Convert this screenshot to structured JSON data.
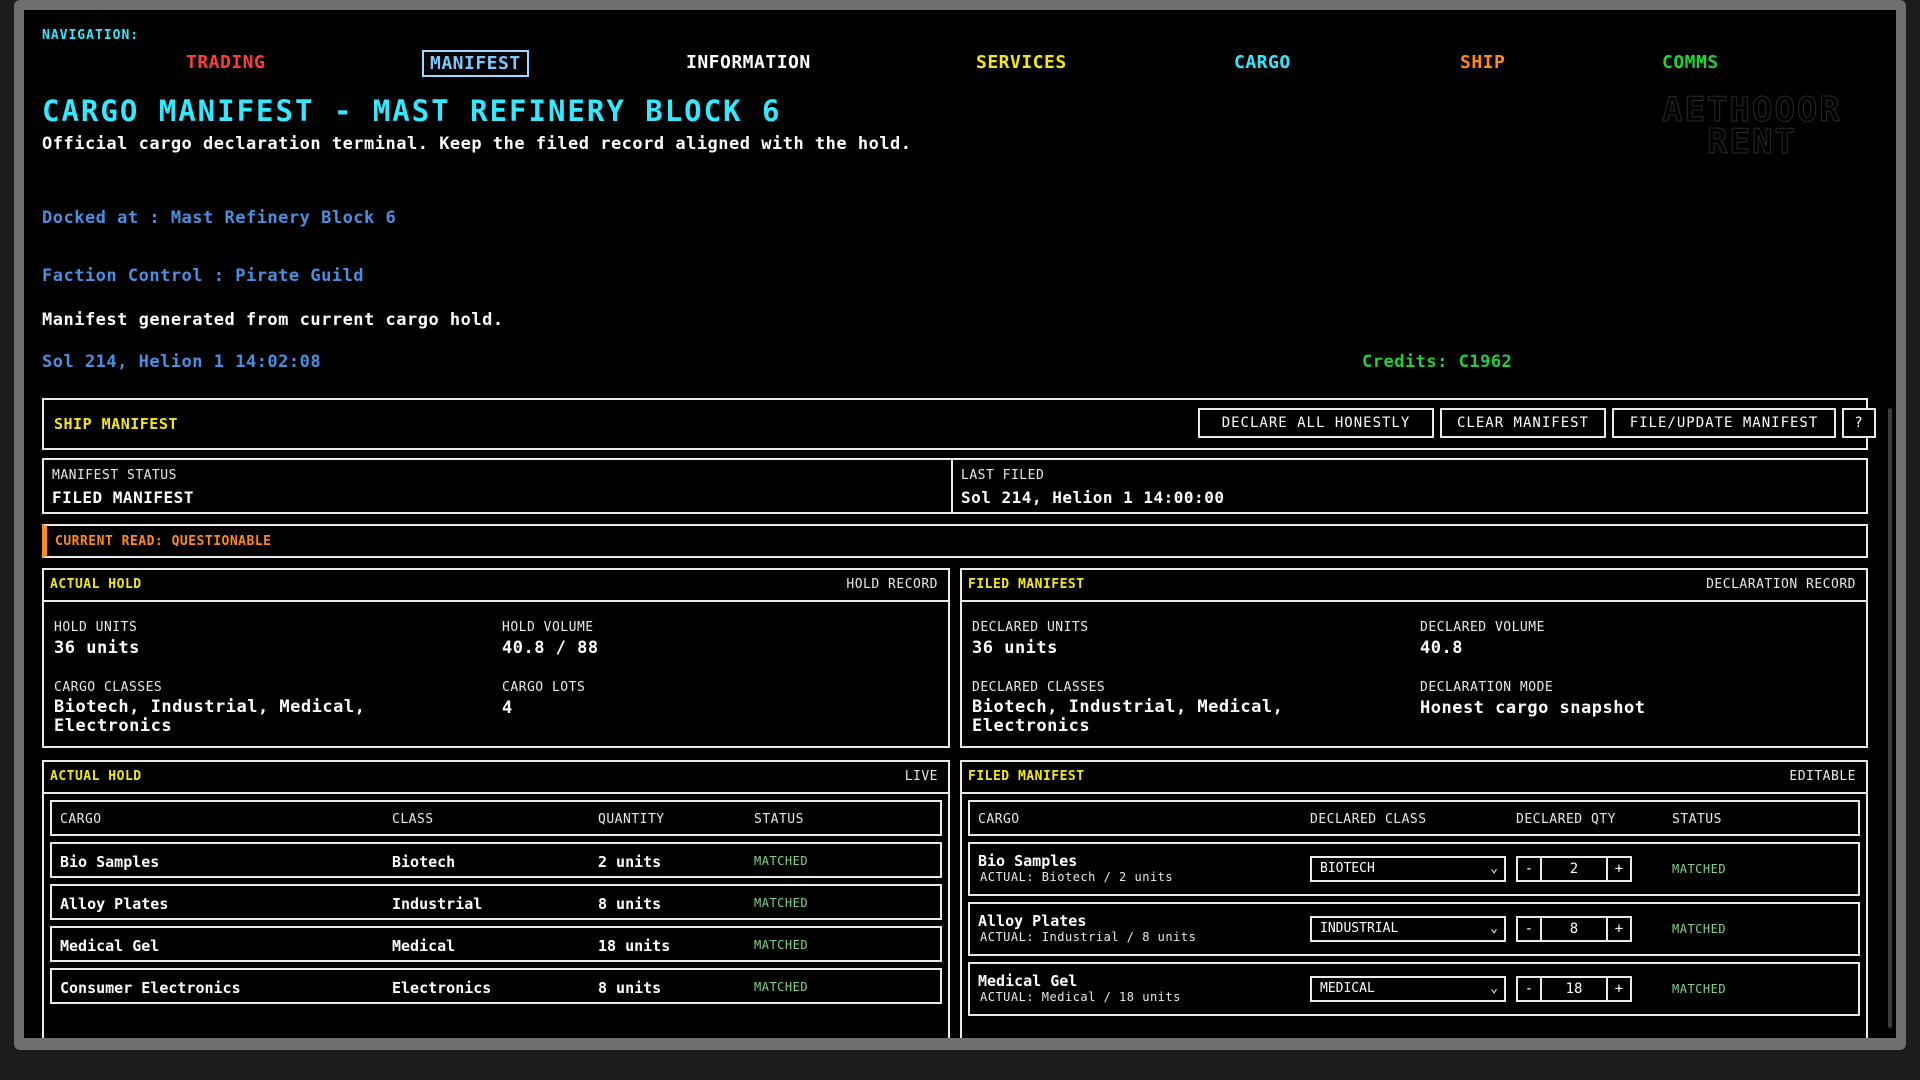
{
  "nav": {
    "label": "NAVIGATION:",
    "items": [
      {
        "label": "TRADING",
        "color": "#ff3b3b"
      },
      {
        "label": "MANIFEST",
        "color": "#7ec8ff"
      },
      {
        "label": "INFORMATION",
        "color": "#ffffff"
      },
      {
        "label": "SERVICES",
        "color": "#f4e61a"
      },
      {
        "label": "CARGO",
        "color": "#34e8ff"
      },
      {
        "label": "SHIP",
        "color": "#ff8a1a"
      },
      {
        "label": "COMMS",
        "color": "#22d03a"
      }
    ]
  },
  "header": {
    "title": "CARGO MANIFEST - MAST REFINERY BLOCK 6",
    "subtitle": "Official cargo declaration terminal. Keep the filed record aligned with the hold.",
    "docked": "Docked at : Mast Refinery Block 6",
    "faction": "Faction Control : Pirate Guild",
    "generated": "Manifest generated from current cargo hold.",
    "datetime": "Sol 214, Helion 1 14:02:08",
    "credits": "Credits: C1962",
    "logo_line1": "AETHOOOR",
    "logo_line2": "RENT"
  },
  "ship_manifest": {
    "title": "SHIP MANIFEST",
    "buttons": {
      "declare": "DECLARE ALL HONESTLY",
      "clear": "CLEAR MANIFEST",
      "file": "FILE/UPDATE MANIFEST",
      "help": "?"
    }
  },
  "status": {
    "manifest_status_label": "MANIFEST STATUS",
    "manifest_status_value": "FILED MANIFEST",
    "last_filed_label": "LAST FILED",
    "last_filed_value": "Sol 214, Helion 1 14:00:00",
    "current_read": "CURRENT READ: QUESTIONABLE"
  },
  "actual_summary": {
    "title": "ACTUAL HOLD",
    "tag": "HOLD RECORD",
    "units_label": "HOLD UNITS",
    "units_value": "36 units",
    "volume_label": "HOLD VOLUME",
    "volume_value": "40.8 / 88",
    "classes_label": "CARGO CLASSES",
    "classes_value": "Biotech, Industrial, Medical, Electronics",
    "lots_label": "CARGO LOTS",
    "lots_value": "4"
  },
  "filed_summary": {
    "title": "FILED MANIFEST",
    "tag": "DECLARATION RECORD",
    "units_label": "DECLARED UNITS",
    "units_value": "36 units",
    "volume_label": "DECLARED VOLUME",
    "volume_value": "40.8",
    "classes_label": "DECLARED CLASSES",
    "classes_value": "Biotech, Industrial, Medical, Electronics",
    "mode_label": "DECLARATION MODE",
    "mode_value": "Honest cargo snapshot"
  },
  "actual_table": {
    "title": "ACTUAL HOLD",
    "tag": "LIVE",
    "headers": {
      "cargo": "CARGO",
      "class": "CLASS",
      "quantity": "QUANTITY",
      "status": "STATUS"
    },
    "rows": [
      {
        "cargo": "Bio Samples",
        "class": "Biotech",
        "quantity": "2 units",
        "status": "MATCHED"
      },
      {
        "cargo": "Alloy Plates",
        "class": "Industrial",
        "quantity": "8 units",
        "status": "MATCHED"
      },
      {
        "cargo": "Medical Gel",
        "class": "Medical",
        "quantity": "18 units",
        "status": "MATCHED"
      },
      {
        "cargo": "Consumer Electronics",
        "class": "Electronics",
        "quantity": "8 units",
        "status": "MATCHED"
      }
    ]
  },
  "filed_table": {
    "title": "FILED MANIFEST",
    "tag": "EDITABLE",
    "headers": {
      "cargo": "CARGO",
      "class": "DECLARED CLASS",
      "qty": "DECLARED QTY",
      "status": "STATUS"
    },
    "rows": [
      {
        "cargo": "Bio Samples",
        "actual": "ACTUAL: Biotech / 2 units",
        "class": "BIOTECH",
        "qty": "2",
        "status": "MATCHED"
      },
      {
        "cargo": "Alloy Plates",
        "actual": "ACTUAL: Industrial / 8 units",
        "class": "INDUSTRIAL",
        "qty": "8",
        "status": "MATCHED"
      },
      {
        "cargo": "Medical Gel",
        "actual": "ACTUAL: Medical / 18 units",
        "class": "MEDICAL",
        "qty": "18",
        "status": "MATCHED"
      }
    ]
  },
  "glyphs": {
    "chevron": "⌄",
    "minus": "-",
    "plus": "+"
  },
  "colors": {
    "yellow": "#f4e61a",
    "cyan": "#34e8ff",
    "blue": "#4a90e2",
    "green": "#22d03a",
    "orange": "#ff8a1a",
    "matched": "#7fd48a"
  }
}
